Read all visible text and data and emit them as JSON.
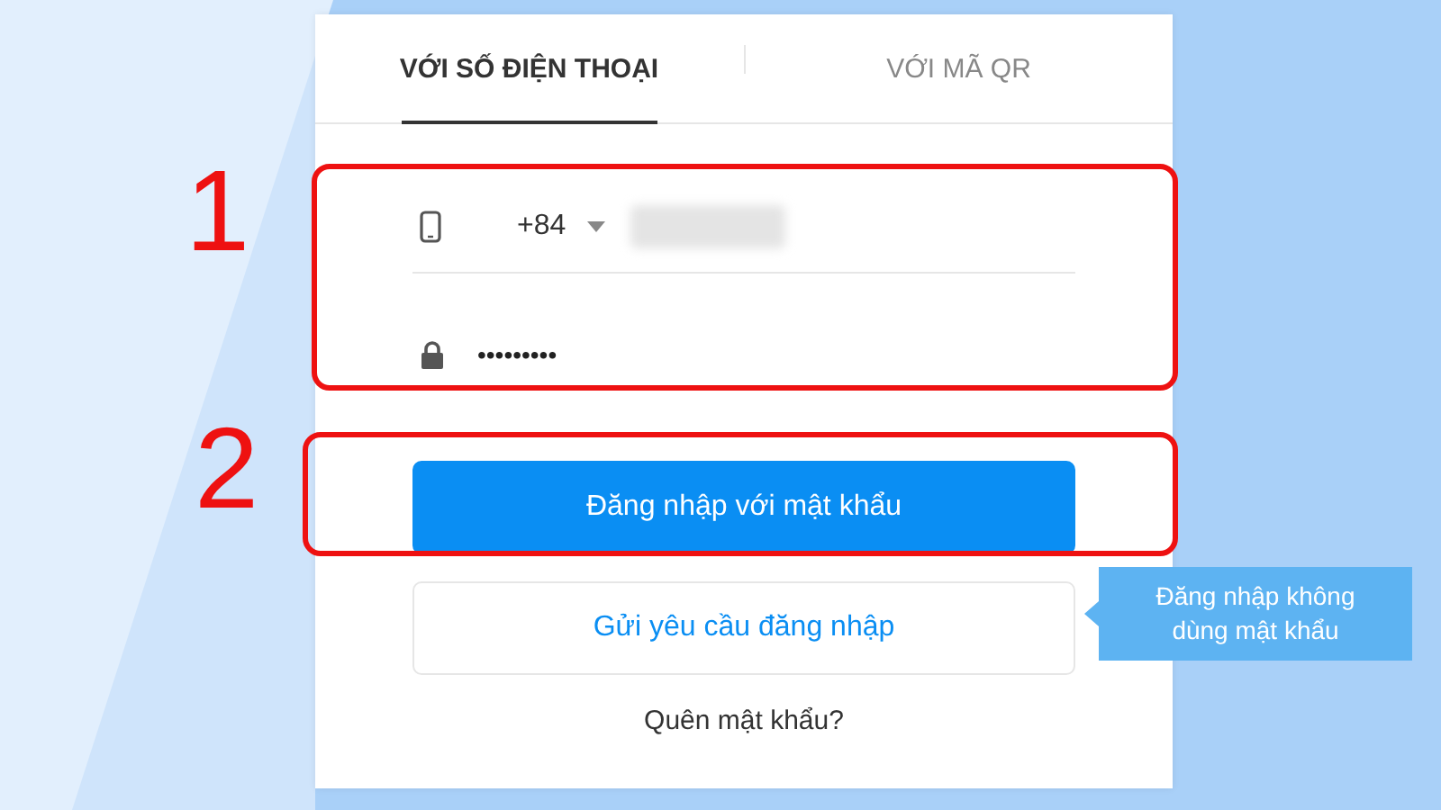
{
  "tabs": [
    {
      "label": "VỚI SỐ ĐIỆN THOẠI",
      "selected": true
    },
    {
      "label": "VỚI MÃ QR",
      "selected": false
    }
  ],
  "phone": {
    "country_code": "+84"
  },
  "password": {
    "value": "•••••••••"
  },
  "primary_button": "Đăng nhập với mật khẩu",
  "secondary_button": "Gửi yêu cầu đăng nhập",
  "tooltip": "Đăng nhập không dùng mật khẩu",
  "forgot_link": "Quên mật khẩu?",
  "annotations": [
    {
      "label": "1"
    },
    {
      "label": "2"
    }
  ]
}
